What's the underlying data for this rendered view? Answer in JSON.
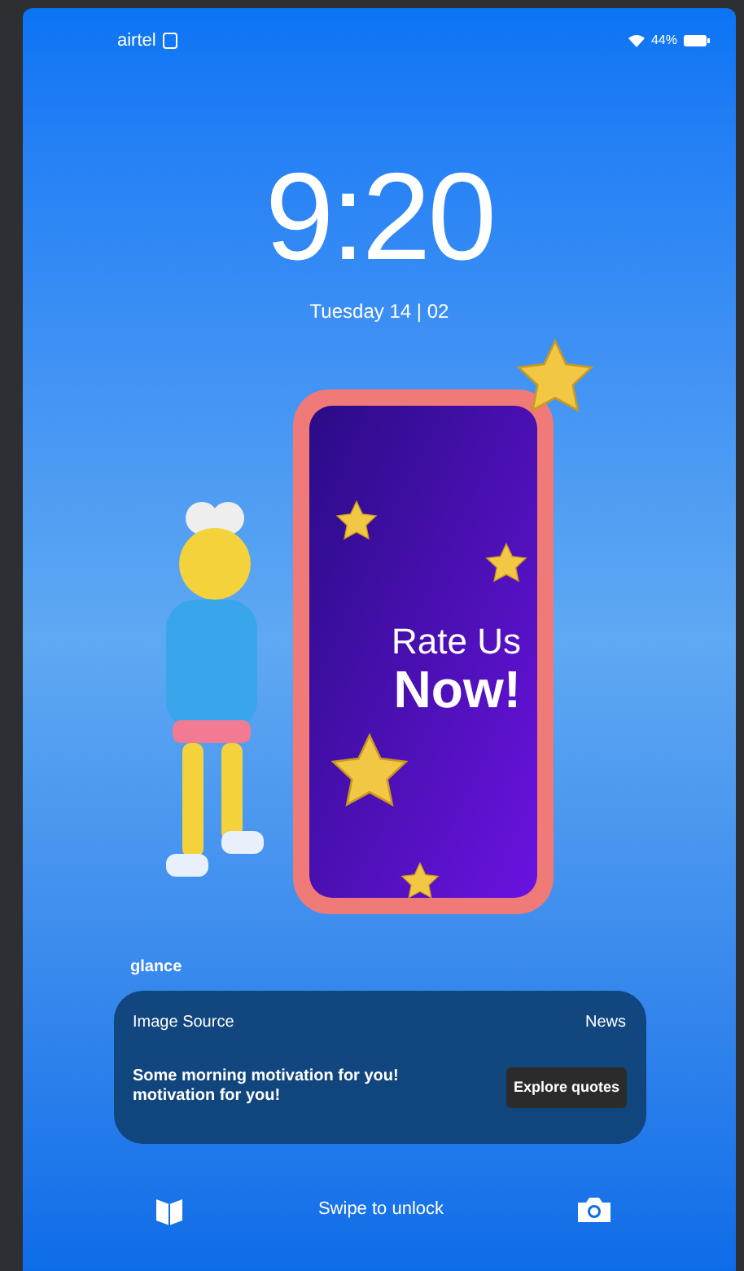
{
  "status_bar": {
    "carrier": "airtel",
    "battery": "44%"
  },
  "clock": {
    "time": "9:20",
    "date": "Tuesday 14 | 02"
  },
  "wallpaper": {
    "headline": "Rate Us",
    "headline_big": "Now!"
  },
  "brand": "glance",
  "notification": {
    "source": "Image Source",
    "category": "News",
    "message": "Some morning motivation for you!\nmotivation for you!",
    "action": "Explore quotes"
  },
  "bottom_bar": {
    "hint": "Swipe to unlock"
  }
}
